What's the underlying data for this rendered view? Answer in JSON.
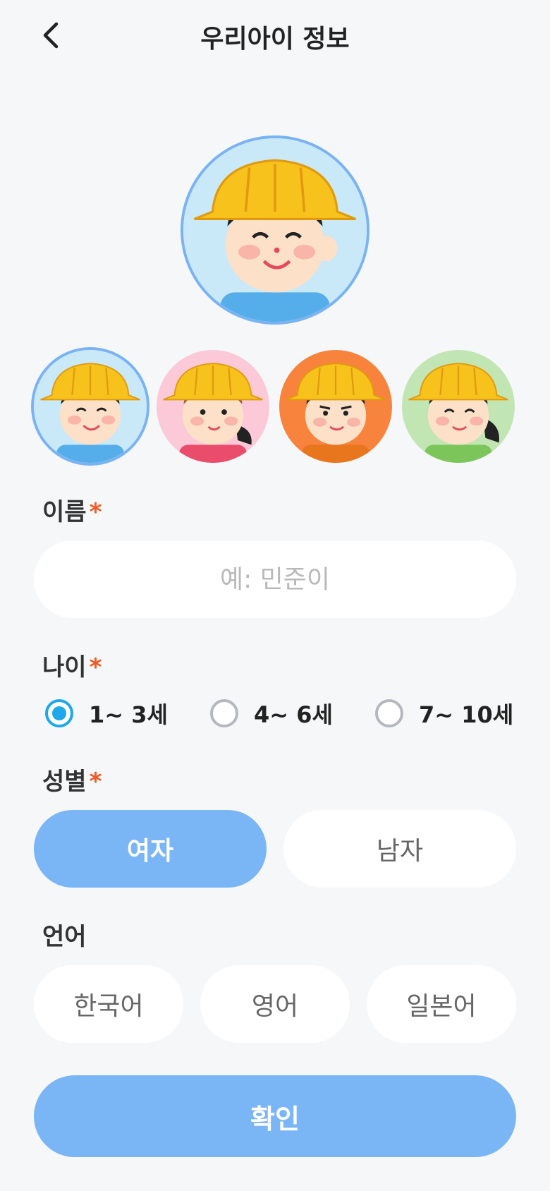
{
  "header": {
    "title": "우리아이 정보",
    "back_icon": "chevron-left-icon"
  },
  "avatars": {
    "main": {
      "bg": "#c9e8f8",
      "shirt": "#55aee9",
      "hair": "long-short",
      "selected_index": 0
    },
    "options": [
      {
        "bg": "#c9e8f8",
        "shirt": "#55aee9",
        "selected": true
      },
      {
        "bg": "#fbc9d7",
        "shirt": "#ea4d6b",
        "selected": false
      },
      {
        "bg": "#f7833d",
        "shirt": "#f08a2e",
        "selected": false
      },
      {
        "bg": "#c2e5b4",
        "shirt": "#7cc55b",
        "selected": false
      }
    ]
  },
  "name": {
    "label": "이름",
    "required_mark": "*",
    "placeholder": "예: 민준이",
    "value": ""
  },
  "age": {
    "label": "나이",
    "required_mark": "*",
    "options": [
      "1~ 3세",
      "4~ 6세",
      "7~ 10세"
    ],
    "selected": "1~ 3세"
  },
  "gender": {
    "label": "성별",
    "required_mark": "*",
    "options": [
      "여자",
      "남자"
    ],
    "selected": "여자"
  },
  "language": {
    "label": "언어",
    "options": [
      "한국어",
      "영어",
      "일본어"
    ]
  },
  "confirm_label": "확인",
  "colors": {
    "accent": "#7ab6f5",
    "radio": "#1ea7ea",
    "required": "#f05a24",
    "background": "#f6f7f8"
  }
}
